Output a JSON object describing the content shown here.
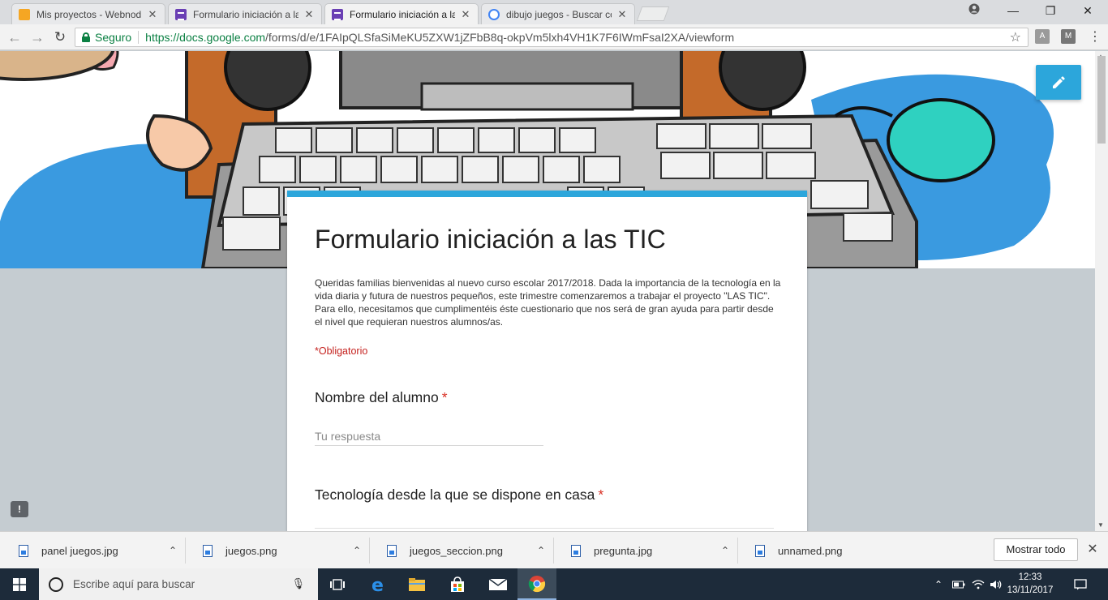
{
  "tabs": [
    {
      "title": "Mis proyectos - Webnod",
      "favicon": "webnode-icon"
    },
    {
      "title": "Formulario iniciación a la",
      "favicon": "google-forms-icon"
    },
    {
      "title": "Formulario iniciación a la",
      "favicon": "google-forms-icon"
    },
    {
      "title": "dibujo juegos - Buscar co",
      "favicon": "google-icon"
    }
  ],
  "window_controls": {
    "minimize": "—",
    "maximize": "❐",
    "close": "✕"
  },
  "address_bar": {
    "secure_label": "Seguro",
    "url_host": "https://docs.google.com",
    "url_path": "/forms/d/e/1FAIpQLSfaSiMeKU5ZXW1jZFbB8q-okpVm5lxh4VH1K7F6IWmFsaI2XA/viewform"
  },
  "form": {
    "title": "Formulario iniciación a las TIC",
    "description": "Queridas familias bienvenidas al nuevo curso escolar 2017/2018. Dada la importancia de la tecnología en la vida diaria y futura de nuestros pequeños, este trimestre comenzaremos a trabajar el proyecto \"LAS TIC\". Para ello, necesitamos que cumplimentéis éste cuestionario que nos será de gran ayuda para partir desde el nivel que requieran nuestros alumnos/as.",
    "required_note": "*Obligatorio",
    "questions": [
      {
        "label": "Nombre del alumno",
        "required_mark": "*",
        "placeholder": "Tu respuesta"
      },
      {
        "label": "Tecnología desde la que se dispone en casa",
        "required_mark": "*"
      }
    ],
    "accent_color": "#2ca6db"
  },
  "downloads": {
    "items": [
      {
        "name": "panel juegos.jpg"
      },
      {
        "name": "juegos.png"
      },
      {
        "name": "juegos_seccion.png"
      },
      {
        "name": "pregunta.jpg"
      },
      {
        "name": "unnamed.png"
      }
    ],
    "show_all_label": "Mostrar todo"
  },
  "taskbar": {
    "search_placeholder": "Escribe aquí para buscar",
    "time": "12:33",
    "date": "13/11/2017"
  }
}
